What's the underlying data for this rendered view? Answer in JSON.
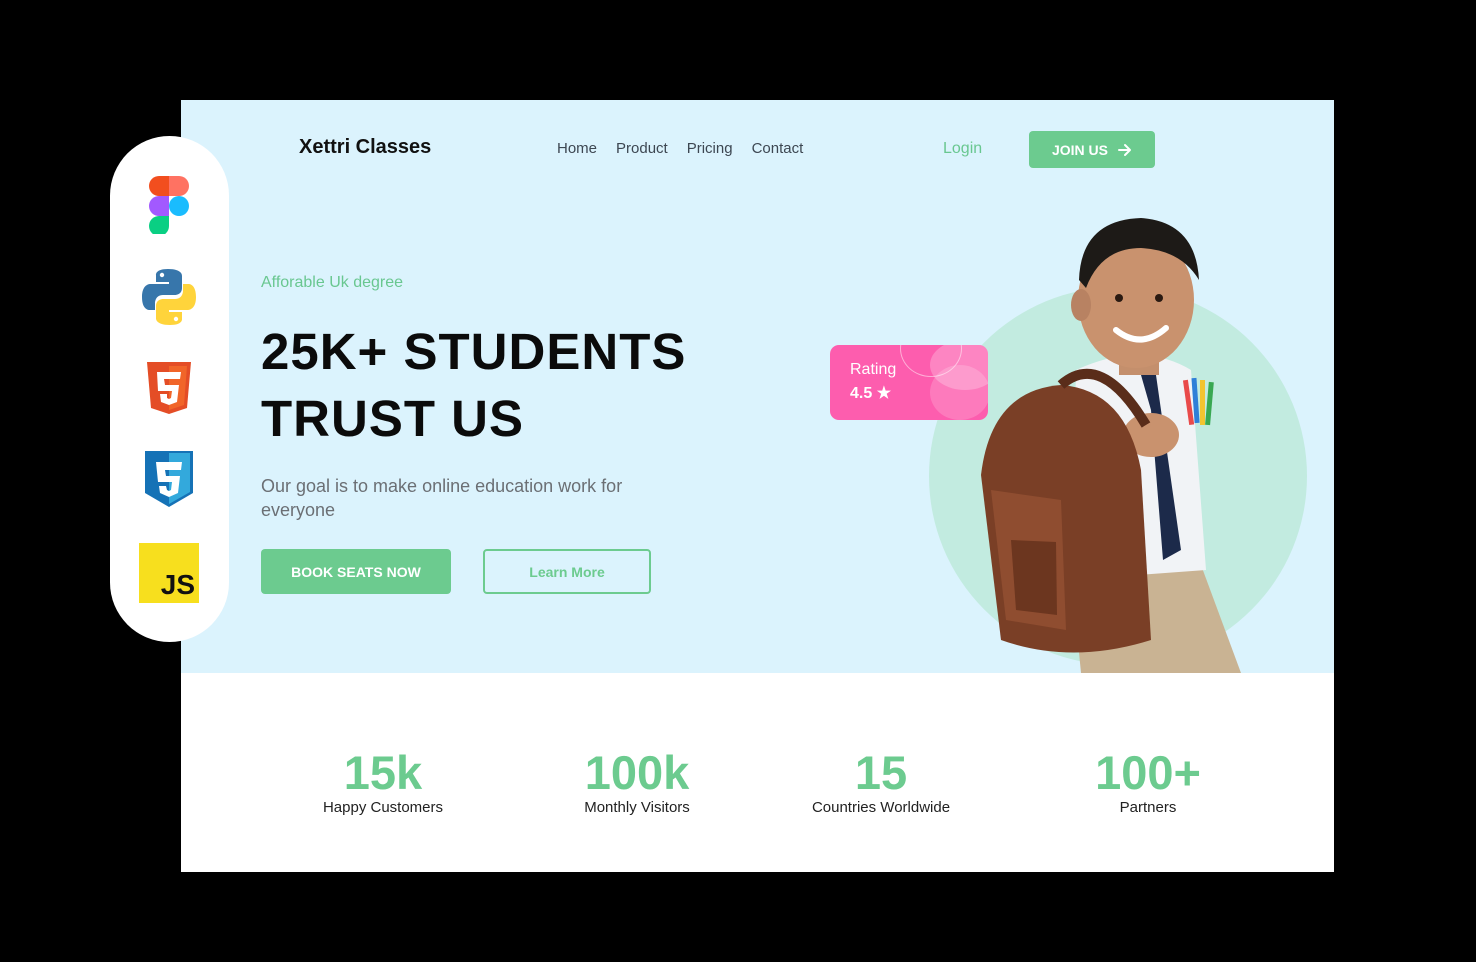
{
  "header": {
    "brand": "Xettri Classes",
    "nav": [
      "Home",
      "Product",
      "Pricing",
      "Contact"
    ],
    "login": "Login",
    "join": "JOIN US"
  },
  "hero": {
    "tagline": "Afforable Uk degree",
    "headline_line1": "25K+ STUDENTS",
    "headline_line2": "TRUST US",
    "description": "Our goal is to make online education work for everyone",
    "primary_cta": "BOOK SEATS NOW",
    "secondary_cta": "Learn More",
    "rating_label": "Rating",
    "rating_value": "4.5 ★"
  },
  "stats": [
    {
      "value": "15k",
      "label": "Happy Customers"
    },
    {
      "value": "100k",
      "label": "Monthly Visitors"
    },
    {
      "value": "15",
      "label": "Countries Worldwide"
    },
    {
      "value": "100+",
      "label": "Partners"
    }
  ],
  "tech_icons": [
    "figma-icon",
    "python-icon",
    "html5-icon",
    "css3-icon",
    "javascript-icon"
  ],
  "tech_texts": {
    "html": "5",
    "css": "3",
    "js": "JS"
  },
  "colors": {
    "accent": "#6ccb8f",
    "hero_bg": "#dbf3fd",
    "rating_bg": "#fd5dae",
    "circle": "#c2ebe0"
  }
}
